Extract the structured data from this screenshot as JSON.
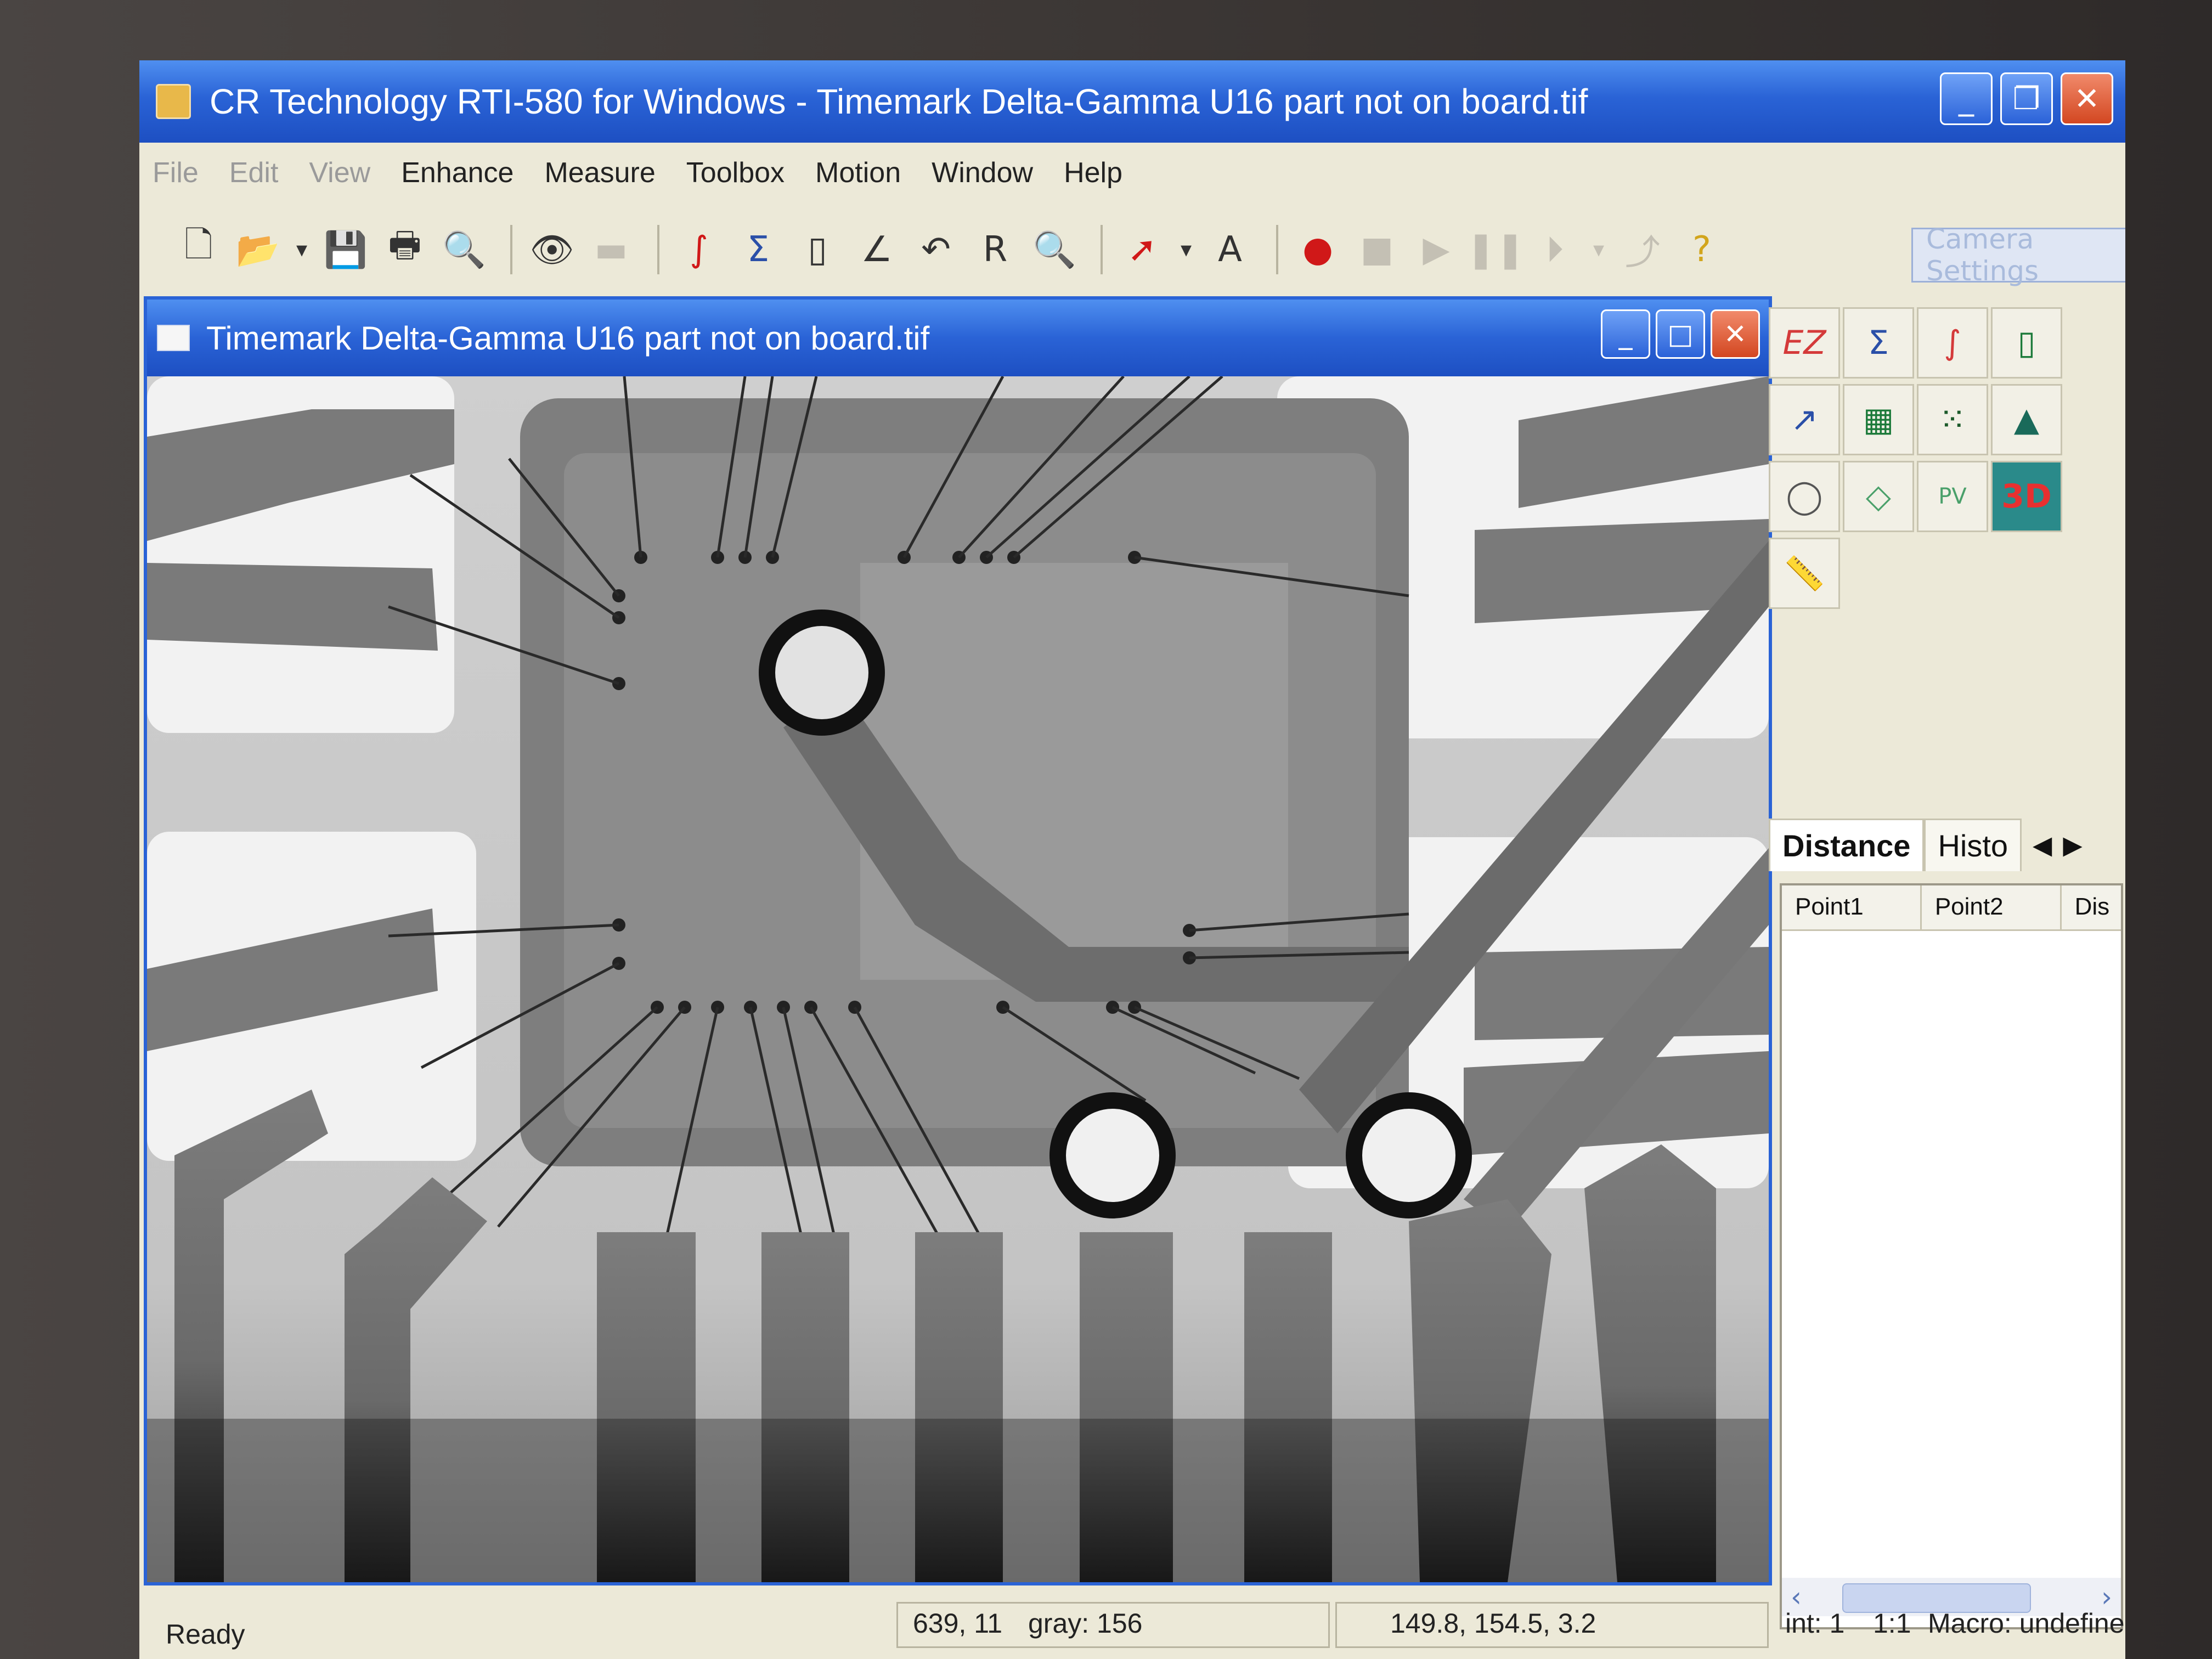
{
  "app": {
    "title": "CR Technology RTI-580 for Windows - Timemark Delta-Gamma U16 part not on board.tif",
    "window_buttons": [
      "_",
      "❐",
      "✕"
    ]
  },
  "menu": {
    "items": [
      "File",
      "Edit",
      "View",
      "Enhance",
      "Measure",
      "Toolbox",
      "Motion",
      "Window",
      "Help"
    ]
  },
  "toolbar": {
    "camera_settings_label": "Camera Settings",
    "glyphs": {
      "new": "🗋",
      "open": "📂",
      "dropdown": "▾",
      "save": "💾",
      "print": "🖶",
      "preview": "🔍",
      "eye": "👁",
      "camera": "▬",
      "integral": "∫",
      "sum": "Σ",
      "frame": "▯",
      "graph": "∠",
      "undo": "↶",
      "r": "R",
      "zoom": "🔍",
      "arrow": "➚",
      "text": "A",
      "record": "●",
      "stop": "■",
      "play": "▶",
      "pause": "❚❚",
      "step": "⏵",
      "export": "⤴",
      "help": "?"
    }
  },
  "child_window": {
    "title": "Timemark Delta-Gamma U16 part not on board.tif",
    "buttons": [
      "_",
      "□",
      "✕"
    ]
  },
  "tools": {
    "ez": "EZ",
    "sum_n": "Σ",
    "integral": "∫",
    "frame": "▯",
    "graph": "↗",
    "grid_edit": "▦",
    "dots": "⁙",
    "surface": "▲",
    "circle": "◯",
    "shape1": "◇",
    "pv": "PV",
    "three_d": "3D",
    "ruler": "📏"
  },
  "panel": {
    "tabs": [
      "Distance",
      "Histo"
    ],
    "arrows": [
      "◀",
      "▶"
    ],
    "columns": [
      "Point1",
      "Point2",
      "Dis"
    ],
    "scroll": [
      "‹",
      "›"
    ]
  },
  "status": {
    "ready": "Ready",
    "coords": "639, 11",
    "gray": "gray: 156",
    "measure": "149.8, 154.5, 3.2",
    "int": "int: 1",
    "ratio": "1:1",
    "macro": "Macro: undefined"
  }
}
